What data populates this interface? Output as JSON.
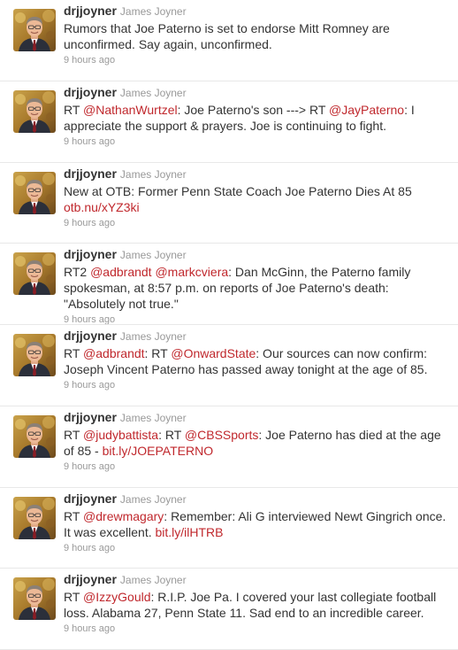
{
  "colors": {
    "link": "#c0282d",
    "name": "#333333",
    "muted": "#999999",
    "divider": "#e8e8e8"
  },
  "tweets": [
    {
      "screen_name": "drjjoyner",
      "full_name": "James Joyner",
      "avatar_icon": "profile-photo",
      "segments": [
        {
          "text": "Rumors that Joe Paterno is set to endorse Mitt Romney are unconfirmed. Say again, unconfirmed.",
          "link": false
        }
      ],
      "time": "9 hours ago"
    },
    {
      "screen_name": "drjjoyner",
      "full_name": "James Joyner",
      "avatar_icon": "profile-photo",
      "segments": [
        {
          "text": "RT ",
          "link": false
        },
        {
          "text": "@NathanWurtzel",
          "link": true
        },
        {
          "text": ": Joe Paterno's son ---> RT ",
          "link": false
        },
        {
          "text": "@JayPaterno",
          "link": true
        },
        {
          "text": ": I appreciate the support & prayers. Joe is continuing to fight.",
          "link": false
        }
      ],
      "time": "9 hours ago"
    },
    {
      "screen_name": "drjjoyner",
      "full_name": "James Joyner",
      "avatar_icon": "profile-photo",
      "segments": [
        {
          "text": "New at OTB: Former Penn State Coach Joe Paterno Dies At 85 ",
          "link": false
        },
        {
          "text": "otb.nu/xYZ3ki",
          "link": true
        }
      ],
      "time": "9 hours ago"
    },
    {
      "screen_name": "drjjoyner",
      "full_name": "James Joyner",
      "avatar_icon": "profile-photo",
      "segments": [
        {
          "text": "RT2 ",
          "link": false
        },
        {
          "text": "@adbrandt",
          "link": true
        },
        {
          "text": " ",
          "link": false
        },
        {
          "text": "@markcviera",
          "link": true
        },
        {
          "text": ": Dan McGinn, the Paterno family spokesman, at 8:57 p.m. on reports of Joe Paterno's death: \"Absolutely not true.\"",
          "link": false
        }
      ],
      "time": "9 hours ago"
    },
    {
      "screen_name": "drjjoyner",
      "full_name": "James Joyner",
      "avatar_icon": "profile-photo",
      "segments": [
        {
          "text": "RT ",
          "link": false
        },
        {
          "text": "@adbrandt",
          "link": true
        },
        {
          "text": ": RT ",
          "link": false
        },
        {
          "text": "@OnwardState",
          "link": true
        },
        {
          "text": ": Our sources can now confirm: Joseph Vincent Paterno has passed away tonight at the age of 85.",
          "link": false
        }
      ],
      "time": "9 hours ago"
    },
    {
      "screen_name": "drjjoyner",
      "full_name": "James Joyner",
      "avatar_icon": "profile-photo",
      "segments": [
        {
          "text": "RT ",
          "link": false
        },
        {
          "text": "@judybattista",
          "link": true
        },
        {
          "text": ": RT ",
          "link": false
        },
        {
          "text": "@CBSSports",
          "link": true
        },
        {
          "text": ": Joe Paterno has died at the age of 85 - ",
          "link": false
        },
        {
          "text": "bit.ly/JOEPATERNO",
          "link": true
        }
      ],
      "time": "9 hours ago"
    },
    {
      "screen_name": "drjjoyner",
      "full_name": "James Joyner",
      "avatar_icon": "profile-photo",
      "segments": [
        {
          "text": "RT ",
          "link": false
        },
        {
          "text": "@drewmagary",
          "link": true
        },
        {
          "text": ": Remember: Ali G interviewed Newt Gingrich once. It was excellent. ",
          "link": false
        },
        {
          "text": "bit.ly/ilHTRB",
          "link": true
        }
      ],
      "time": "9 hours ago"
    },
    {
      "screen_name": "drjjoyner",
      "full_name": "James Joyner",
      "avatar_icon": "profile-photo",
      "segments": [
        {
          "text": "RT ",
          "link": false
        },
        {
          "text": "@IzzyGould",
          "link": true
        },
        {
          "text": ": R.I.P. Joe Pa. I covered your last collegiate football loss. Alabama 27, Penn State 11. Sad end to an incredible career.",
          "link": false
        }
      ],
      "time": "9 hours ago"
    }
  ]
}
